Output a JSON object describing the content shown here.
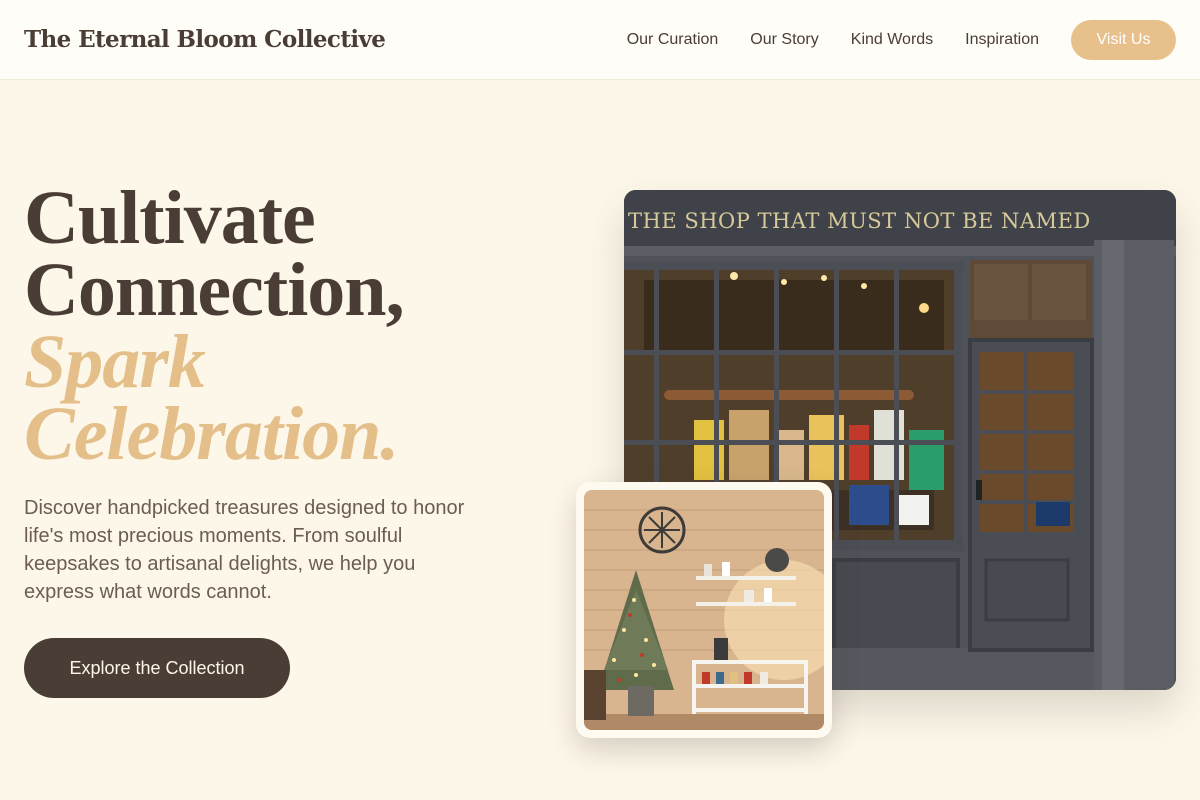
{
  "header": {
    "brand": "The Eternal Bloom Collective",
    "nav": [
      {
        "label": "Our Curation"
      },
      {
        "label": "Our Story"
      },
      {
        "label": "Kind Words"
      },
      {
        "label": "Inspiration"
      }
    ],
    "cta_label": "Visit Us"
  },
  "hero": {
    "title_line1": "Cultivate",
    "title_line2": "Connection,",
    "accent_line1": "Spark",
    "accent_line2": "Celebration.",
    "description": "Discover handpicked treasures designed to honor life's most precious moments. From soulful keepsakes to artisanal delights, we help you express what words cannot.",
    "cta_label": "Explore the Collection"
  },
  "images": {
    "storefront_sign": "THE SHOP THAT MUST NOT BE NAMED"
  },
  "colors": {
    "background": "#fdf7e9",
    "text_dark": "#4a3d35",
    "accent": "#e4bf8a",
    "button_accent": "#e8c08c"
  }
}
